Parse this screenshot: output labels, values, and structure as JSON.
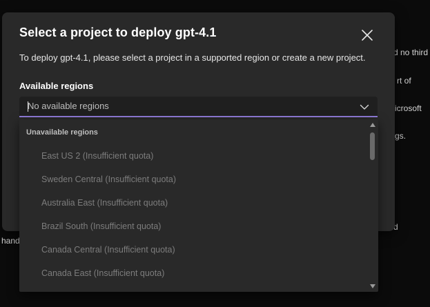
{
  "background": {
    "fragments": [
      "d no third",
      "rt of",
      "icrosoft",
      "gs.",
      "d",
      "hand"
    ]
  },
  "dialog": {
    "title": "Select a project to deploy gpt-4.1",
    "description": "To deploy gpt-4.1, please select a project in a supported region or create a new project.",
    "close_icon": "close-icon",
    "field_label": "Available regions",
    "combo_value": "No available regions",
    "combo_icon": "chevron-down-icon",
    "accent_color": "#8f7bd8"
  },
  "listbox": {
    "group_header": "Unavailable regions",
    "options": [
      "East US 2 (Insufficient quota)",
      "Sweden Central (Insufficient quota)",
      "Australia East (Insufficient quota)",
      "Brazil South (Insufficient quota)",
      "Canada Central (Insufficient quota)",
      "Canada East (Insufficient quota)"
    ]
  }
}
